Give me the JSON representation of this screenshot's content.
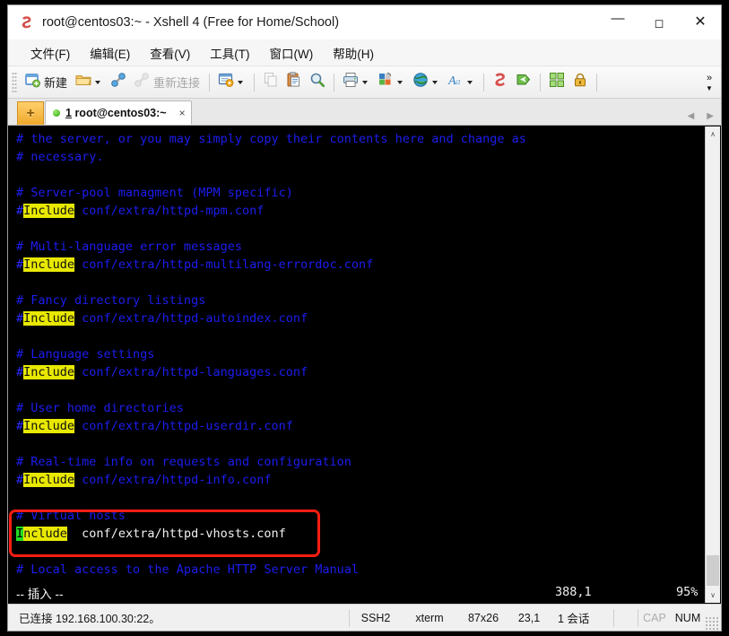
{
  "window": {
    "title": "root@centos03:~ - Xshell 4 (Free for Home/School)",
    "app_icon": "xshell-icon",
    "controls": {
      "minimize": "—",
      "maximize": "☐",
      "close": "✕"
    }
  },
  "menubar": {
    "items": [
      {
        "label": "文件(F)",
        "name": "menu-file"
      },
      {
        "label": "编辑(E)",
        "name": "menu-edit"
      },
      {
        "label": "查看(V)",
        "name": "menu-view"
      },
      {
        "label": "工具(T)",
        "name": "menu-tools"
      },
      {
        "label": "窗口(W)",
        "name": "menu-window"
      },
      {
        "label": "帮助(H)",
        "name": "menu-help"
      }
    ]
  },
  "toolbar": {
    "new_label": "新建",
    "reconnect_label": "重新连接",
    "overflow_label": "»",
    "overflow_chevron": "▼",
    "icons": [
      "new-session-icon",
      "open-folder-icon",
      "connect-icon",
      "disconnect-icon",
      "session-manager-icon",
      "copy-icon",
      "paste-icon",
      "find-icon",
      "print-icon",
      "color-scheme-icon",
      "globe-icon",
      "font-icon",
      "xshell-icon",
      "xftp-icon",
      "fullscreen-icon",
      "lock-icon"
    ]
  },
  "tabbar": {
    "new_tab_label": "+",
    "tabs": [
      {
        "index": "1",
        "title": "root@centos03:~",
        "close": "×",
        "status": "connected"
      }
    ],
    "scroll_left": "◀",
    "scroll_right": "▶"
  },
  "terminal": {
    "lines": [
      [
        {
          "t": "# the server, or you may simply copy their contents here and change as",
          "c": "comment"
        }
      ],
      [
        {
          "t": "# necessary.",
          "c": "comment"
        }
      ],
      [
        {
          "t": "",
          "c": "comment"
        }
      ],
      [
        {
          "t": "# Server-pool managment (MPM specific)",
          "c": "comment"
        }
      ],
      [
        {
          "t": "#",
          "c": "hash"
        },
        {
          "t": "Include",
          "c": "inc"
        },
        {
          "t": " conf/extra/httpd-mpm.conf",
          "c": "comment"
        }
      ],
      [
        {
          "t": "",
          "c": "comment"
        }
      ],
      [
        {
          "t": "# Multi-language error messages",
          "c": "comment"
        }
      ],
      [
        {
          "t": "#",
          "c": "hash"
        },
        {
          "t": "Include",
          "c": "inc"
        },
        {
          "t": " conf/extra/httpd-multilang-errordoc.conf",
          "c": "comment"
        }
      ],
      [
        {
          "t": "",
          "c": "comment"
        }
      ],
      [
        {
          "t": "# Fancy directory listings",
          "c": "comment"
        }
      ],
      [
        {
          "t": "#",
          "c": "hash"
        },
        {
          "t": "Include",
          "c": "inc"
        },
        {
          "t": " conf/extra/httpd-autoindex.conf",
          "c": "comment"
        }
      ],
      [
        {
          "t": "",
          "c": "comment"
        }
      ],
      [
        {
          "t": "# Language settings",
          "c": "comment"
        }
      ],
      [
        {
          "t": "#",
          "c": "hash"
        },
        {
          "t": "Include",
          "c": "inc"
        },
        {
          "t": " conf/extra/httpd-languages.conf",
          "c": "comment"
        }
      ],
      [
        {
          "t": "",
          "c": "comment"
        }
      ],
      [
        {
          "t": "# User home directories",
          "c": "comment"
        }
      ],
      [
        {
          "t": "#",
          "c": "hash"
        },
        {
          "t": "Include",
          "c": "inc"
        },
        {
          "t": " conf/extra/httpd-userdir.conf",
          "c": "comment"
        }
      ],
      [
        {
          "t": "",
          "c": "comment"
        }
      ],
      [
        {
          "t": "# Real-time info on requests and configuration",
          "c": "comment"
        }
      ],
      [
        {
          "t": "#",
          "c": "hash"
        },
        {
          "t": "Include",
          "c": "inc"
        },
        {
          "t": " conf/extra/httpd-info.conf",
          "c": "comment"
        }
      ],
      [
        {
          "t": "",
          "c": "comment"
        }
      ],
      [
        {
          "t": "# Virtual hosts",
          "c": "comment"
        }
      ],
      [
        {
          "t": "I",
          "c": "cursor"
        },
        {
          "t": "nclude",
          "c": "inc"
        },
        {
          "t": "  conf/extra/httpd-vhosts.conf",
          "c": "white"
        }
      ],
      [
        {
          "t": "",
          "c": "comment"
        }
      ],
      [
        {
          "t": "# Local access to the Apache HTTP Server Manual",
          "c": "comment"
        }
      ]
    ],
    "status": {
      "mode": "-- 插入 --",
      "position": "388,1",
      "percent": "95%"
    },
    "annotation": {
      "shape": "rounded-rect",
      "color": "#fb1d13"
    }
  },
  "scrollbar": {
    "up": "∧",
    "down": "∨"
  },
  "statusbar": {
    "connection": "已连接 192.168.100.30:22。",
    "protocol": "SSH2",
    "term_type": "xterm",
    "size": "87x26",
    "cursor": "23,1",
    "sessions": "1 会话",
    "caps": "CAP",
    "num": "NUM"
  }
}
